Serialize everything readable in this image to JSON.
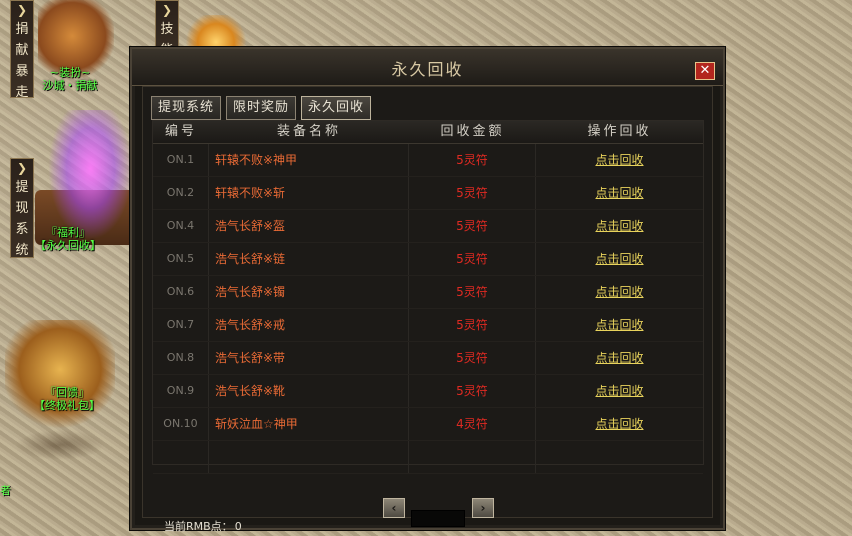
{
  "scene": {
    "left_flags": [
      {
        "chars": [
          "捐",
          "献",
          "暴",
          "走"
        ]
      },
      {
        "chars": [
          "提",
          "现",
          "系",
          "统"
        ]
      }
    ],
    "top_flag": {
      "chars": [
        "技",
        "能"
      ]
    },
    "npc_labels": [
      {
        "line1": "~装扮~",
        "line2": "沙城・捐献"
      },
      {
        "line1": "『福利』",
        "line2": "【永久回收】"
      },
      {
        "line1": "『回馈』",
        "line2": "【终极礼包】"
      }
    ],
    "bottom_left_text": "者"
  },
  "dialog": {
    "title": "永久回收",
    "close_label": "✕",
    "tabs": [
      {
        "label": "提现系统"
      },
      {
        "label": "限时奖励"
      },
      {
        "label": "永久回收"
      }
    ],
    "active_tab": "永久回收",
    "columns": [
      "编号",
      "装备名称",
      "回收金额",
      "操作回收"
    ],
    "rows": [
      {
        "no": "ON.1",
        "name": "轩辕不败※神甲",
        "amount": "5灵符",
        "action": "点击回收"
      },
      {
        "no": "ON.2",
        "name": "轩辕不败※斩",
        "amount": "5灵符",
        "action": "点击回收"
      },
      {
        "no": "ON.4",
        "name": "浩气长舒※盔",
        "amount": "5灵符",
        "action": "点击回收"
      },
      {
        "no": "ON.5",
        "name": "浩气长舒※链",
        "amount": "5灵符",
        "action": "点击回收"
      },
      {
        "no": "ON.6",
        "name": "浩气长舒※镯",
        "amount": "5灵符",
        "action": "点击回收"
      },
      {
        "no": "ON.7",
        "name": "浩气长舒※戒",
        "amount": "5灵符",
        "action": "点击回收"
      },
      {
        "no": "ON.8",
        "name": "浩气长舒※带",
        "amount": "5灵符",
        "action": "点击回收"
      },
      {
        "no": "ON.9",
        "name": "浩气长舒※靴",
        "amount": "5灵符",
        "action": "点击回收"
      },
      {
        "no": "ON.10",
        "name": "斩妖泣血☆神甲",
        "amount": "4灵符",
        "action": "点击回收"
      }
    ],
    "pager": {
      "prev": "‹",
      "next": "›"
    },
    "rmb_label": "当前RMB点：",
    "rmb_value": "0"
  },
  "colors": {
    "item_name": "#e86a35",
    "amount": "#e02a22",
    "action_link": "#e8d35c",
    "npc_label": "#54ff44"
  }
}
